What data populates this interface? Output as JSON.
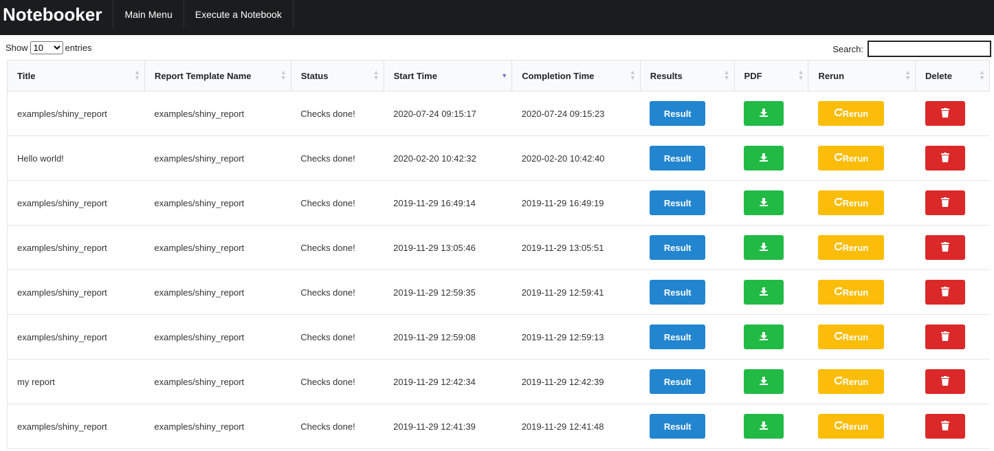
{
  "navbar": {
    "brand": "Notebooker",
    "items": [
      "Main Menu",
      "Execute a Notebook"
    ]
  },
  "controls": {
    "show_label": "Show",
    "entries_value": "10",
    "entries_label": "entries",
    "search_label": "Search:",
    "search_value": ""
  },
  "table": {
    "columns": [
      "Title",
      "Report Template Name",
      "Status",
      "Start Time",
      "Completion Time",
      "Results",
      "PDF",
      "Rerun",
      "Delete"
    ],
    "sorted_column": "Start Time",
    "buttons": {
      "result": "Result",
      "rerun": "Rerun"
    },
    "rows": [
      {
        "title": "examples/shiny_report",
        "template": "examples/shiny_report",
        "status": "Checks done!",
        "start": "2020-07-24 09:15:17",
        "end": "2020-07-24 09:15:23"
      },
      {
        "title": "Hello world!",
        "template": "examples/shiny_report",
        "status": "Checks done!",
        "start": "2020-02-20 10:42:32",
        "end": "2020-02-20 10:42:40"
      },
      {
        "title": "examples/shiny_report",
        "template": "examples/shiny_report",
        "status": "Checks done!",
        "start": "2019-11-29 16:49:14",
        "end": "2019-11-29 16:49:19"
      },
      {
        "title": "examples/shiny_report",
        "template": "examples/shiny_report",
        "status": "Checks done!",
        "start": "2019-11-29 13:05:46",
        "end": "2019-11-29 13:05:51"
      },
      {
        "title": "examples/shiny_report",
        "template": "examples/shiny_report",
        "status": "Checks done!",
        "start": "2019-11-29 12:59:35",
        "end": "2019-11-29 12:59:41"
      },
      {
        "title": "examples/shiny_report",
        "template": "examples/shiny_report",
        "status": "Checks done!",
        "start": "2019-11-29 12:59:08",
        "end": "2019-11-29 12:59:13"
      },
      {
        "title": "my report",
        "template": "examples/shiny_report",
        "status": "Checks done!",
        "start": "2019-11-29 12:42:34",
        "end": "2019-11-29 12:42:39"
      },
      {
        "title": "examples/shiny_report",
        "template": "examples/shiny_report",
        "status": "Checks done!",
        "start": "2019-11-29 12:41:39",
        "end": "2019-11-29 12:41:48"
      }
    ]
  },
  "colors": {
    "result": "#2185d0",
    "pdf": "#21ba45",
    "rerun": "#fbbd08",
    "delete": "#db2828",
    "navbar": "#1b1c1d"
  }
}
